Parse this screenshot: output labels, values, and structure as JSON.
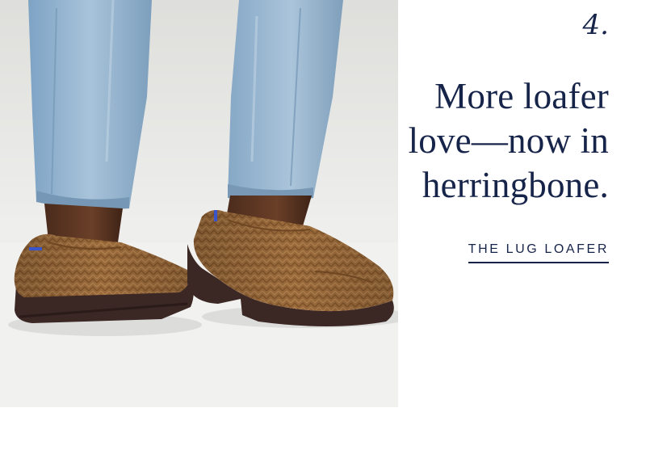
{
  "hero": {
    "image_alt": "Legs in light-wash jeans wearing brown herringbone knit loafers with chunky dark lug soles",
    "colors": {
      "denim": "#8fb0cc",
      "knit": "#9b6b3c",
      "sole": "#3b2724",
      "accent_blue": "#3a55c9",
      "wall": "#ececea"
    }
  },
  "feature": {
    "step": "4.",
    "headline": "More loafer love—now in herringbone.",
    "cta_label": "THE LUG LOAFER",
    "text_color": "#17244a"
  }
}
